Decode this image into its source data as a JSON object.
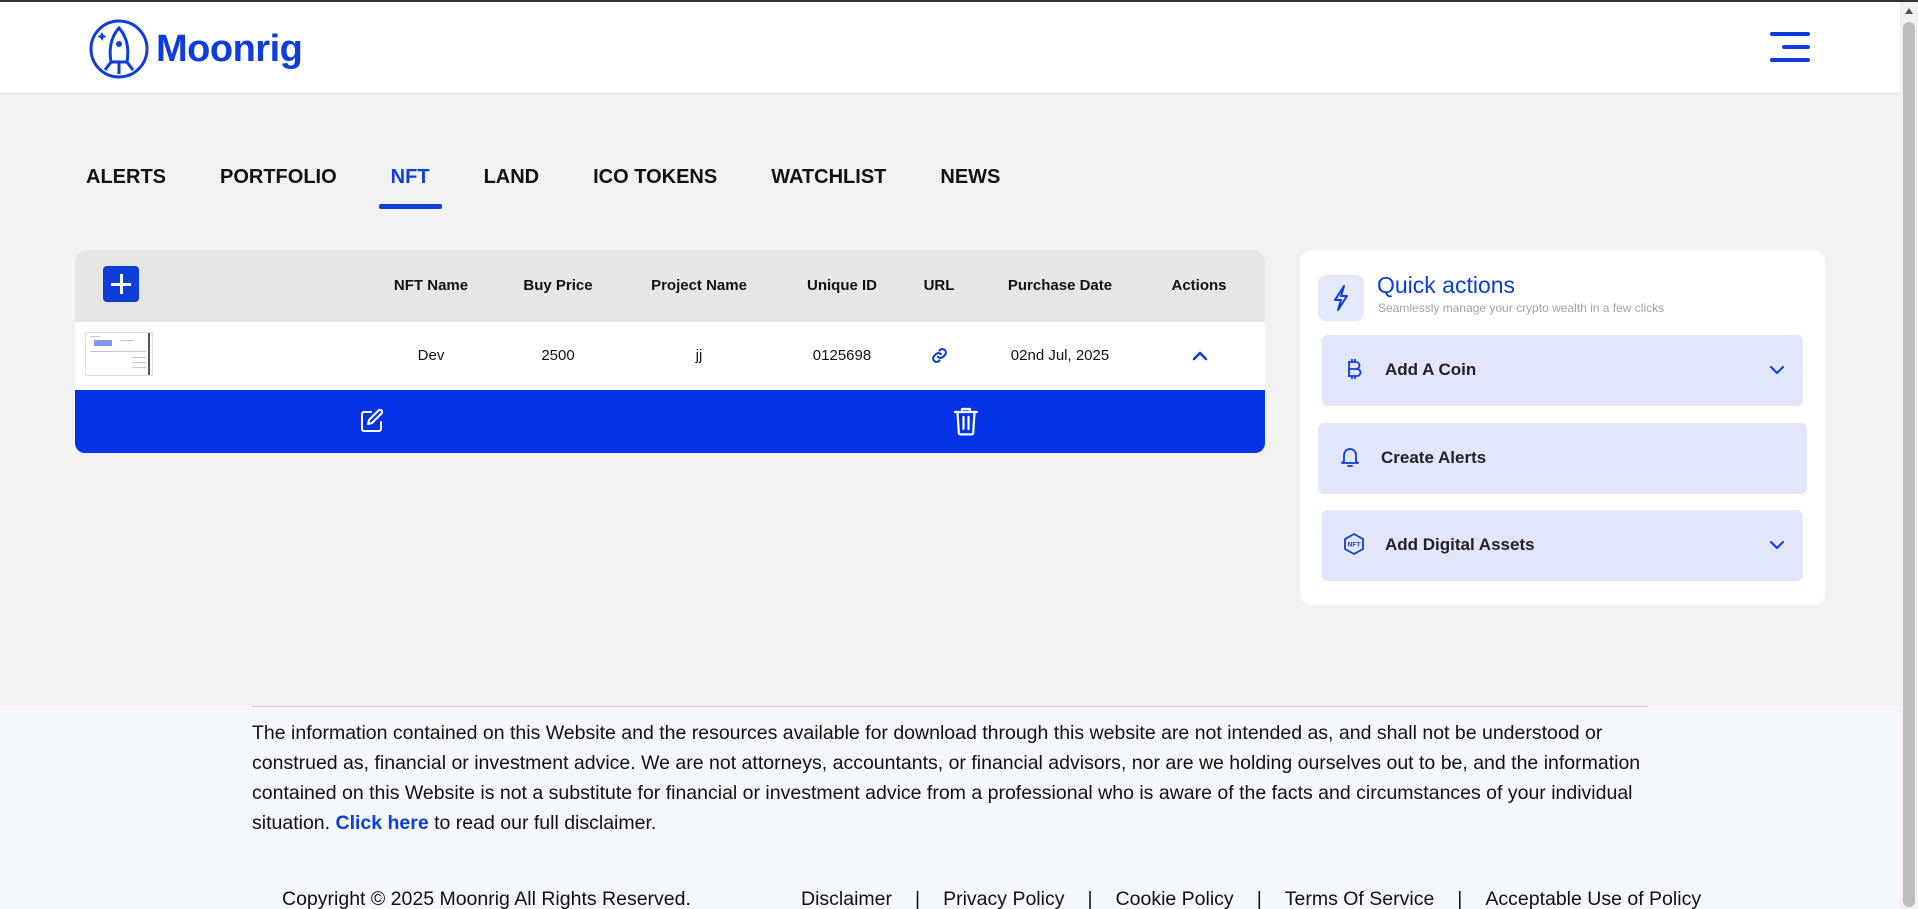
{
  "app": {
    "brand": "Moonrig"
  },
  "tabs": [
    {
      "label": "ALERTS",
      "active": false
    },
    {
      "label": "PORTFOLIO",
      "active": false
    },
    {
      "label": "NFT",
      "active": true
    },
    {
      "label": "LAND",
      "active": false
    },
    {
      "label": "ICO TOKENS",
      "active": false
    },
    {
      "label": "WATCHLIST",
      "active": false
    },
    {
      "label": "NEWS",
      "active": false
    }
  ],
  "table": {
    "columns": [
      "NFT Name",
      "Buy Price",
      "Project Name",
      "Unique ID",
      "URL",
      "Purchase Date",
      "Actions"
    ],
    "rows": [
      {
        "nft_name": "Dev",
        "buy_price": "2500",
        "project_name": "jj",
        "unique_id": "0125698",
        "purchase_date": "02nd Jul, 2025"
      }
    ]
  },
  "quick_actions": {
    "title": "Quick actions",
    "subtitle": "Seamlessly manage your crypto wealth in a few clicks",
    "items": [
      {
        "label": "Add A Coin",
        "icon": "bitcoin-icon",
        "expandable": true
      },
      {
        "label": "Create Alerts",
        "icon": "bell-icon",
        "expandable": false
      },
      {
        "label": "Add Digital Assets",
        "icon": "nft-icon",
        "expandable": true
      }
    ]
  },
  "footer": {
    "disclaimer_text": "The information contained on this Website and the resources available for download through this website are not intended as, and shall not be understood or construed as, financial or investment advice. We are not attorneys, accountants, or financial advisors, nor are we holding ourselves out to be, and the information contained on this Website is not a substitute for financial or investment advice from a professional who is aware of the facts and circumstances of your individual situation.",
    "disclaimer_link": "Click here",
    "disclaimer_tail": "to read our full disclaimer.",
    "copyright": "Copyright © 2025 Moonrig All Rights Reserved.",
    "links": [
      "Disclaimer",
      "Privacy Policy",
      "Cookie Policy",
      "Terms Of Service",
      "Acceptable Use of Policy"
    ],
    "separator": "|"
  },
  "colors": {
    "accent": "#0d3ddb",
    "action_bar": "#0432e6",
    "quick_action_item": "#e2e6fb"
  }
}
